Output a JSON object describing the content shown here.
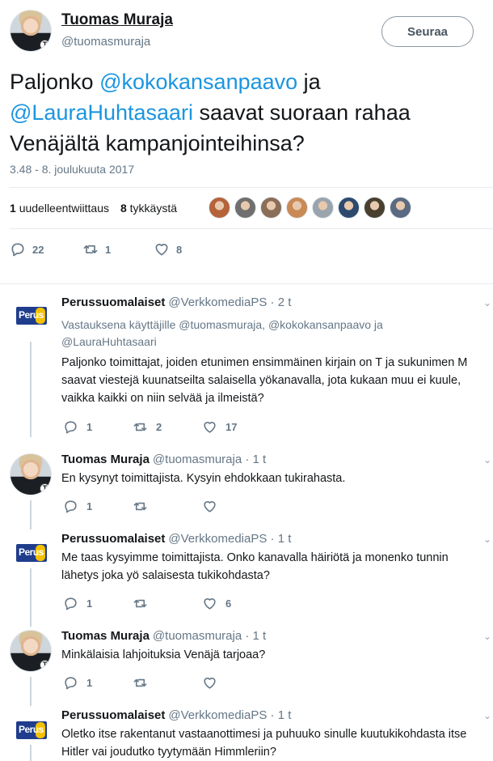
{
  "main_tweet": {
    "author_name": "Tuomas Muraja",
    "author_handle": "@tuomasmuraja",
    "follow_label": "Seuraa",
    "text_part1": "Paljonko ",
    "mention1": "@kokokansanpaavo",
    "text_part2": " ja",
    "mention2": "@LauraHuhtasaari",
    "text_part3": " saavat suoraan rahaa",
    "text_line3": "Venäjältä kampanjointeihinsa?",
    "timestamp": "3.48 - 8. joulukuuta 2017",
    "retweet_count": "1",
    "retweet_label": "uudelleentwiittaus",
    "like_count": "8",
    "like_label": "tykkäystä",
    "likers": [
      {
        "color": "#b5633a"
      },
      {
        "color": "#6f6f6f"
      },
      {
        "color": "#8a6e5a"
      },
      {
        "color": "#c98a55"
      },
      {
        "color": "#9aa4ad"
      },
      {
        "color": "#2d4a6e"
      },
      {
        "color": "#4a4030"
      },
      {
        "color": "#5a6a80"
      }
    ],
    "actions": {
      "replies": "22",
      "retweets": "1",
      "likes": "8"
    }
  },
  "replies": [
    {
      "author_name": "Perussuomalaiset",
      "author_handle": "@VerkkomediaPS",
      "time": "2 t",
      "logo_text": "Perus",
      "replying_to_line1": "Vastauksena käyttäjille @tuomasmuraja, @kokokansanpaavo ja",
      "replying_to_line2": "@LauraHuhtasaari",
      "text_line1": "Paljonko toimittajat, joiden etunimen ensimmäinen kirjain on T ja sukunimen M",
      "text_line2": "saavat viestejä kuunatseilta salaisella yökanavalla, jota kukaan muu ei kuule,",
      "text_line3": "vaikka kaikki on niin selvää ja ilmeistä?",
      "replies": "1",
      "retweets": "2",
      "likes": "17"
    },
    {
      "author_name": "Tuomas Muraja",
      "author_handle": "@tuomasmuraja",
      "time": "1 t",
      "text_line1": "En kysynyt toimittajista. Kysyin ehdokkaan tukirahasta.",
      "replies": "1",
      "retweets": "",
      "likes": ""
    },
    {
      "author_name": "Perussuomalaiset",
      "author_handle": "@VerkkomediaPS",
      "time": "1 t",
      "logo_text": "Perus",
      "text_line1": "Me taas kysyimme toimittajista. Onko kanavalla häiriötä ja monenko tunnin",
      "text_line2": "lähetys joka yö salaisesta tukikohdasta?",
      "replies": "1",
      "retweets": "",
      "likes": "6"
    },
    {
      "author_name": "Tuomas Muraja",
      "author_handle": "@tuomasmuraja",
      "time": "1 t",
      "text_line1": "Minkälaisia lahjoituksia Venäjä tarjoaa?",
      "replies": "1",
      "retweets": "",
      "likes": ""
    },
    {
      "author_name": "Perussuomalaiset",
      "author_handle": "@VerkkomediaPS",
      "time": "1 t",
      "logo_text": "Perus",
      "text_line1": "Oletko itse rakentanut vastaanottimesi ja puhuuko sinulle kuutukikohdasta itse",
      "text_line2": "Hitler vai joudutko tyytymään Himmleriin?"
    }
  ],
  "separator": " · ",
  "badge_letter": "T"
}
